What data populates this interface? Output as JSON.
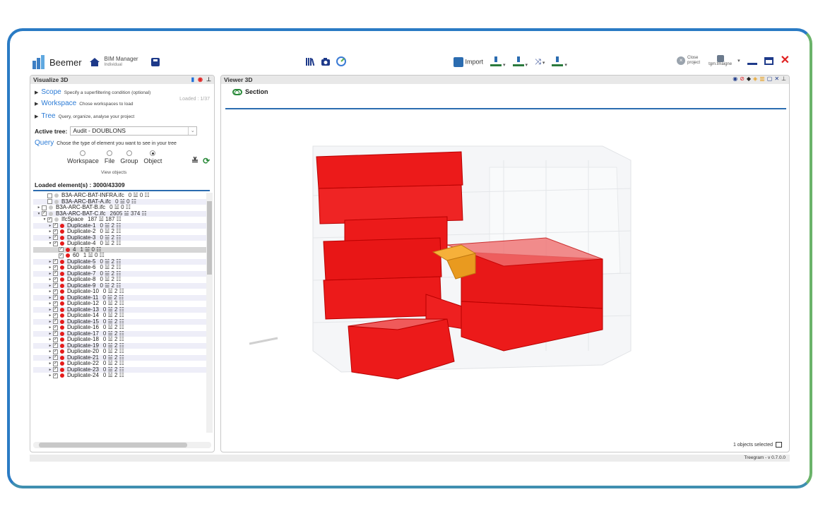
{
  "header": {
    "brand": "Beemer",
    "bim_title": "BIM Manager",
    "bim_sub": "Individual",
    "import_label": "Import",
    "close_line1": "Close",
    "close_line2": "project",
    "user": "tgm.tmaigne"
  },
  "left_panel": {
    "title": "Visualize 3D",
    "scope": {
      "label": "Scope",
      "desc": "Specify a superfiltering condition (optional)"
    },
    "workspace": {
      "label": "Workspace",
      "desc": "Chose workspaces to load",
      "loaded": "Loaded : 1/37"
    },
    "tree": {
      "label": "Tree",
      "desc": "Query, organize, analyse your project"
    },
    "active_tree_label": "Active tree:",
    "active_tree_value": "Audit - DOUBLONS",
    "query": {
      "label": "Query",
      "desc": "Chose the type of element you want to see in your tree"
    },
    "radios": [
      "Workspace",
      "File",
      "Group",
      "Object"
    ],
    "radio_selected": "Object",
    "view_objects": "View objects",
    "loaded_elements": "Loaded element(s) : 3000/43309"
  },
  "tree_rows": [
    {
      "indent": 1,
      "exp": "",
      "cb": "",
      "dot": "grey",
      "text": "B3A-ARC-BAT-INFRA.ifc",
      "count": "0 ☱ 0 ☷"
    },
    {
      "indent": 1,
      "exp": "",
      "cb": "",
      "dot": "grey",
      "text": "B3A-ARC-BAT-A.ifc",
      "count": "0 ☱ 0 ☷"
    },
    {
      "indent": 0,
      "exp": "▸",
      "cb": "",
      "dot": "grey",
      "text": "B3A-ARC-BAT-B.ifc",
      "count": "0 ☱ 0 ☷"
    },
    {
      "indent": 0,
      "exp": "▾",
      "cb": "✓",
      "dot": "grey",
      "text": "B3A-ARC-BAT-C.ifc",
      "count": "2605 ☱ 374 ☷"
    },
    {
      "indent": 1,
      "exp": "▾",
      "cb": "✓",
      "dot": "grey",
      "text": "IfcSpace",
      "count": "187 ☱ 187 ☷"
    },
    {
      "indent": 2,
      "exp": "▸",
      "cb": "✓",
      "dot": "red",
      "text": "Duplicate-1",
      "count": "0 ☱ 2 ☷"
    },
    {
      "indent": 2,
      "exp": "▸",
      "cb": "✓",
      "dot": "red",
      "text": "Duplicate-2",
      "count": "0 ☱ 2 ☷"
    },
    {
      "indent": 2,
      "exp": "▸",
      "cb": "✓",
      "dot": "red",
      "text": "Duplicate-3",
      "count": "0 ☱ 2 ☷"
    },
    {
      "indent": 2,
      "exp": "▾",
      "cb": "✓",
      "dot": "red",
      "text": "Duplicate-4",
      "count": "0 ☱ 2 ☷"
    },
    {
      "indent": 3,
      "exp": "",
      "cb": "✓",
      "dot": "red",
      "text": "4",
      "count": "1 ☱ 0 ☷",
      "hl": true
    },
    {
      "indent": 3,
      "exp": "",
      "cb": "✓",
      "dot": "red",
      "text": "60",
      "count": "1 ☱ 0 ☷"
    },
    {
      "indent": 2,
      "exp": "▸",
      "cb": "✓",
      "dot": "red",
      "text": "Duplicate-5",
      "count": "0 ☱ 2 ☷"
    },
    {
      "indent": 2,
      "exp": "▸",
      "cb": "✓",
      "dot": "red",
      "text": "Duplicate-6",
      "count": "0 ☱ 2 ☷"
    },
    {
      "indent": 2,
      "exp": "▸",
      "cb": "✓",
      "dot": "red",
      "text": "Duplicate-7",
      "count": "0 ☱ 2 ☷"
    },
    {
      "indent": 2,
      "exp": "▸",
      "cb": "✓",
      "dot": "red",
      "text": "Duplicate-8",
      "count": "0 ☱ 2 ☷"
    },
    {
      "indent": 2,
      "exp": "▸",
      "cb": "✓",
      "dot": "red",
      "text": "Duplicate-9",
      "count": "0 ☱ 2 ☷"
    },
    {
      "indent": 2,
      "exp": "▸",
      "cb": "✓",
      "dot": "red",
      "text": "Duplicate-10",
      "count": "0 ☱ 2 ☷"
    },
    {
      "indent": 2,
      "exp": "▸",
      "cb": "✓",
      "dot": "red",
      "text": "Duplicate-11",
      "count": "0 ☱ 2 ☷"
    },
    {
      "indent": 2,
      "exp": "▸",
      "cb": "✓",
      "dot": "red",
      "text": "Duplicate-12",
      "count": "0 ☱ 2 ☷"
    },
    {
      "indent": 2,
      "exp": "▸",
      "cb": "✓",
      "dot": "red",
      "text": "Duplicate-13",
      "count": "0 ☱ 2 ☷"
    },
    {
      "indent": 2,
      "exp": "▸",
      "cb": "✓",
      "dot": "red",
      "text": "Duplicate-14",
      "count": "0 ☱ 2 ☷"
    },
    {
      "indent": 2,
      "exp": "▸",
      "cb": "✓",
      "dot": "red",
      "text": "Duplicate-15",
      "count": "0 ☱ 2 ☷"
    },
    {
      "indent": 2,
      "exp": "▸",
      "cb": "✓",
      "dot": "red",
      "text": "Duplicate-16",
      "count": "0 ☱ 2 ☷"
    },
    {
      "indent": 2,
      "exp": "▸",
      "cb": "✓",
      "dot": "red",
      "text": "Duplicate-17",
      "count": "0 ☱ 2 ☷"
    },
    {
      "indent": 2,
      "exp": "▸",
      "cb": "✓",
      "dot": "red",
      "text": "Duplicate-18",
      "count": "0 ☱ 2 ☷"
    },
    {
      "indent": 2,
      "exp": "▸",
      "cb": "✓",
      "dot": "red",
      "text": "Duplicate-19",
      "count": "0 ☱ 2 ☷"
    },
    {
      "indent": 2,
      "exp": "▸",
      "cb": "✓",
      "dot": "red",
      "text": "Duplicate-20",
      "count": "0 ☱ 2 ☷"
    },
    {
      "indent": 2,
      "exp": "▸",
      "cb": "✓",
      "dot": "red",
      "text": "Duplicate-21",
      "count": "0 ☱ 2 ☷"
    },
    {
      "indent": 2,
      "exp": "▸",
      "cb": "✓",
      "dot": "red",
      "text": "Duplicate-22",
      "count": "0 ☱ 2 ☷"
    },
    {
      "indent": 2,
      "exp": "▸",
      "cb": "✓",
      "dot": "red",
      "text": "Duplicate-23",
      "count": "0 ☱ 2 ☷"
    },
    {
      "indent": 2,
      "exp": "▸",
      "cb": "✓",
      "dot": "red",
      "text": "Duplicate-24",
      "count": "0 ☱ 2 ☷"
    }
  ],
  "viewer": {
    "title": "Viewer 3D",
    "section_label": "Section",
    "selected_text": "1 objects selected"
  },
  "footer": {
    "version": "Treegram - v 0.7.0.0"
  },
  "colors": {
    "accent": "#2b6cb0",
    "duplicate": "#e51b1b",
    "selected": "#f0a020",
    "section_toggle": "#2a8a3a"
  }
}
